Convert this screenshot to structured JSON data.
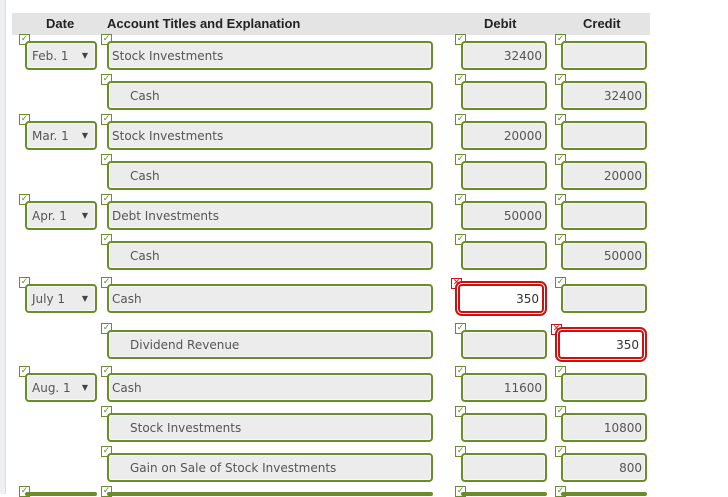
{
  "headers": {
    "date": "Date",
    "account": "Account Titles and Explanation",
    "debit": "Debit",
    "credit": "Credit"
  },
  "rows": [
    {
      "date": "Feb. 1",
      "account": "Stock Investments",
      "debit": "32400",
      "credit": ""
    },
    {
      "date": "",
      "account": "Cash",
      "debit": "",
      "credit": "32400"
    },
    {
      "date": "Mar. 1",
      "account": "Stock Investments",
      "debit": "20000",
      "credit": ""
    },
    {
      "date": "",
      "account": "Cash",
      "debit": "",
      "credit": "20000"
    },
    {
      "date": "Apr. 1",
      "account": "Debt Investments",
      "debit": "50000",
      "credit": ""
    },
    {
      "date": "",
      "account": "Cash",
      "debit": "",
      "credit": "50000"
    },
    {
      "date": "July 1",
      "account": "Cash",
      "debit": "350",
      "credit": ""
    },
    {
      "date": "",
      "account": "Dividend Revenue",
      "debit": "",
      "credit": "350"
    },
    {
      "date": "Aug. 1",
      "account": "Cash",
      "debit": "11600",
      "credit": ""
    },
    {
      "date": "",
      "account": "Stock Investments",
      "debit": "",
      "credit": "10800"
    },
    {
      "date": "",
      "account": "Gain on Sale of Stock Investments",
      "debit": "",
      "credit": "800"
    }
  ],
  "colors": {
    "correct_border": "#6a8d2a",
    "error_border": "#cc1111",
    "field_bg": "#ececec",
    "header_bg": "#e4e4e4"
  },
  "icons": {
    "check": "check-icon",
    "error": "x-icon",
    "dropdown": "chevron-down-icon"
  },
  "glyphs": {
    "check": "✓",
    "error": "✕",
    "dropdown": "▼"
  }
}
